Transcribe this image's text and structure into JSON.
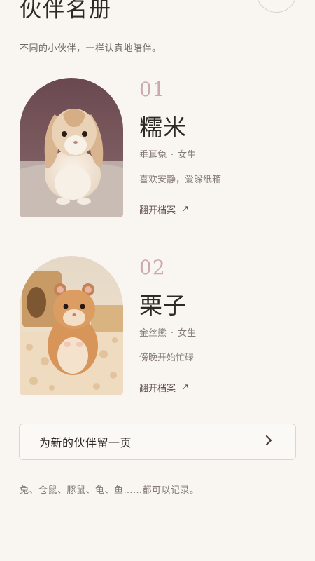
{
  "header": {
    "title": "伙伴名册",
    "subtitle": "不同的小伙伴，一样认真地陪伴。"
  },
  "pets": [
    {
      "number": "01",
      "name": "糯米",
      "species": "垂耳兔",
      "gender": "女生",
      "description": "喜欢安静，爱躲纸箱",
      "link_label": "翻开档案",
      "link_icon": "↗",
      "photo": "lop-eared-rabbit-photo"
    },
    {
      "number": "02",
      "name": "栗子",
      "species": "金丝熊",
      "gender": "女生",
      "description": "傍晚开始忙碌",
      "link_label": "翻开档案",
      "link_icon": "↗",
      "photo": "golden-hamster-photo"
    }
  ],
  "meta_separator": "·",
  "add_button": {
    "label": "为新的伙伴留一页",
    "icon": "chevron-right-icon"
  },
  "footer_note": "兔、仓鼠、豚鼠、龟、鱼……都可以记录。",
  "colors": {
    "background": "#f9f6f2",
    "number_accent": "#c9a9ac",
    "text_primary": "#2f2926",
    "text_secondary": "#857b76"
  }
}
